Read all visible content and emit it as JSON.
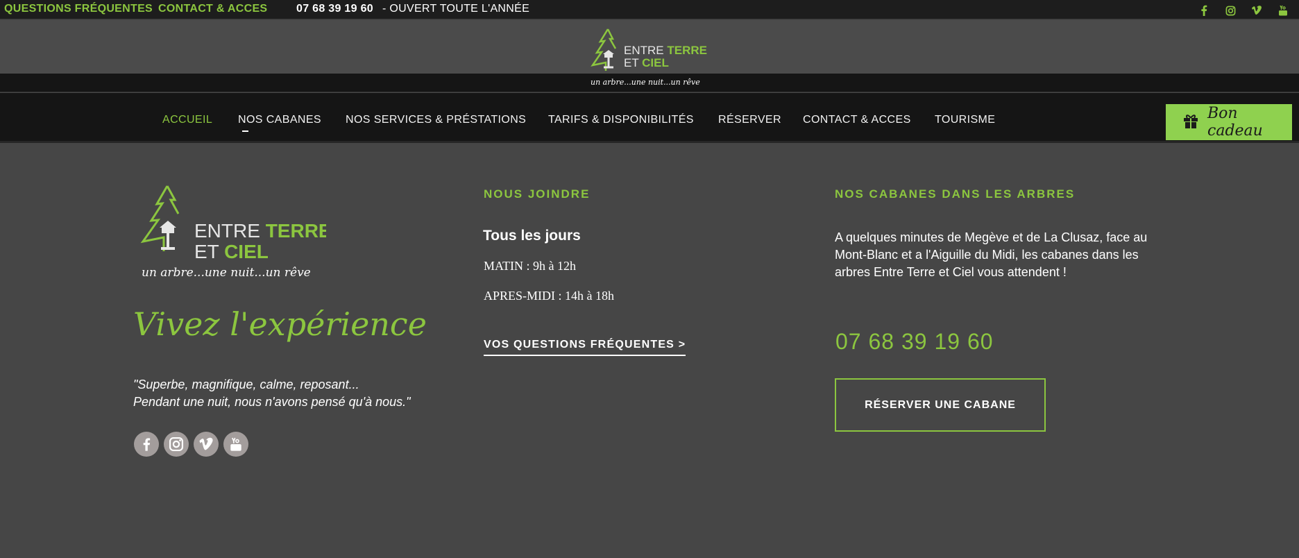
{
  "topbar": {
    "faq": "QUESTIONS FRÉQUENTES",
    "contact": "CONTACT & ACCES",
    "phone": "07 68 39 19 60",
    "open": " - OUVERT TOUTE L'ANNÉE",
    "social_icons": [
      "facebook-icon",
      "instagram-icon",
      "vimeo-icon",
      "youtube-icon"
    ]
  },
  "logo": {
    "line1_a": "ENTRE ",
    "line1_b": "TERRE",
    "line2_a": "ET ",
    "line2_b": "CIEL",
    "tagline": "un arbre...une nuit...un rêve"
  },
  "nav": {
    "items": [
      "ACCUEIL",
      "NOS CABANES",
      "NOS SERVICES & PRÉSTATIONS",
      "TARIFS & DISPONIBILITÉS",
      "RÉSERVER",
      "CONTACT & ACCES",
      "TOURISME"
    ],
    "active": "ACCUEIL",
    "gift_label": "Bon cadeau"
  },
  "footer": {
    "col1": {
      "headline": "Vivez l'expérience",
      "quote_line1": "\"Superbe, magnifique, calme, reposant...",
      "quote_line2": "Pendant une nuit, nous n'avons pensé qu'à nous.\""
    },
    "col2": {
      "title": "NOUS JOINDRE",
      "days": "Tous les jours",
      "morning": "MATIN : 9h à 12h",
      "afternoon": "APRES-MIDI : 14h à 18h",
      "faq_link": "VOS QUESTIONS FRÉQUENTES >"
    },
    "col3": {
      "title": "NOS CABANES DANS LES ARBRES",
      "description": "A quelques minutes de Megève et de La Clusaz, face au Mont-Blanc et a l'Aiguille du Midi, les cabanes dans les arbres Entre Terre et Ciel vous attendent !",
      "phone": "07 68 39 19 60",
      "reserve_button": "RÉSERVER UNE CABANE"
    }
  },
  "colors": {
    "accent": "#8cc63f",
    "gift_button": "#8fd14f",
    "background": "#464646",
    "nav_bg": "#151515"
  }
}
